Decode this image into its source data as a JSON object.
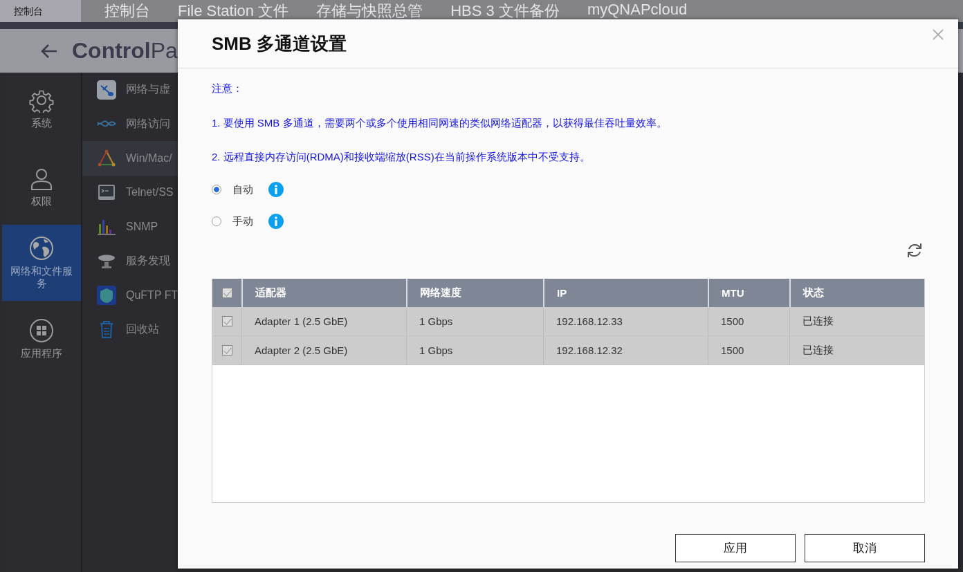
{
  "top_bar": {
    "title": "控制台",
    "ghost_tabs": [
      "控制台",
      "File Station 文件",
      "存储与快照总管",
      "HBS 3 文件备份",
      "myQNAPcloud"
    ]
  },
  "header": {
    "title": "**Control**Pa"
  },
  "sidebar": {
    "items": [
      {
        "label": "系统",
        "kind": "gear",
        "selected": false
      },
      {
        "label": "权限",
        "kind": "user",
        "selected": false
      },
      {
        "label": "网络和文件服务",
        "kind": "globe",
        "selected": true
      },
      {
        "label": "应用程序",
        "kind": "apps",
        "selected": false
      }
    ]
  },
  "menu": {
    "items": [
      {
        "label": "网络与虚",
        "kind": "network",
        "selected": false
      },
      {
        "label": "网络访问",
        "kind": "wave",
        "selected": false
      },
      {
        "label": "Win/Mac/",
        "kind": "triangle",
        "selected": true
      },
      {
        "label": "Telnet/SS",
        "kind": "terminal",
        "selected": false
      },
      {
        "label": "SNMP",
        "kind": "bars",
        "selected": false
      },
      {
        "label": "服务发现",
        "kind": "dish",
        "selected": false
      },
      {
        "label": "QuFTP FT",
        "kind": "ftp",
        "selected": false
      },
      {
        "label": "回收站",
        "kind": "trash",
        "selected": false
      }
    ]
  },
  "dialog": {
    "title": "SMB 多通道设置",
    "notes": [
      "注意：",
      "1. 要使用 SMB 多通道，需要两个或多个使用相同网速的类似网络适配器，以获得最佳吞吐量效率。",
      "2. 远程直接内存访问(RDMA)和接收端缩放(RSS)在当前操作系统版本中不受支持。"
    ],
    "modes": [
      {
        "label": "自动",
        "selected": true
      },
      {
        "label": "手动",
        "selected": false
      }
    ],
    "table": {
      "all_checked": true,
      "columns": [
        "适配器",
        "网络速度",
        "IP",
        "MTU",
        "状态"
      ],
      "rows": [
        {
          "checked": true,
          "cells": [
            "Adapter 1 (2.5 GbE)",
            "1 Gbps",
            "192.168.12.33",
            "1500",
            "已连接"
          ]
        },
        {
          "checked": true,
          "cells": [
            "Adapter 2 (2.5 GbE)",
            "1 Gbps",
            "192.168.12.32",
            "1500",
            "已连接"
          ]
        }
      ]
    },
    "buttons": [
      "应用",
      "取消"
    ]
  }
}
